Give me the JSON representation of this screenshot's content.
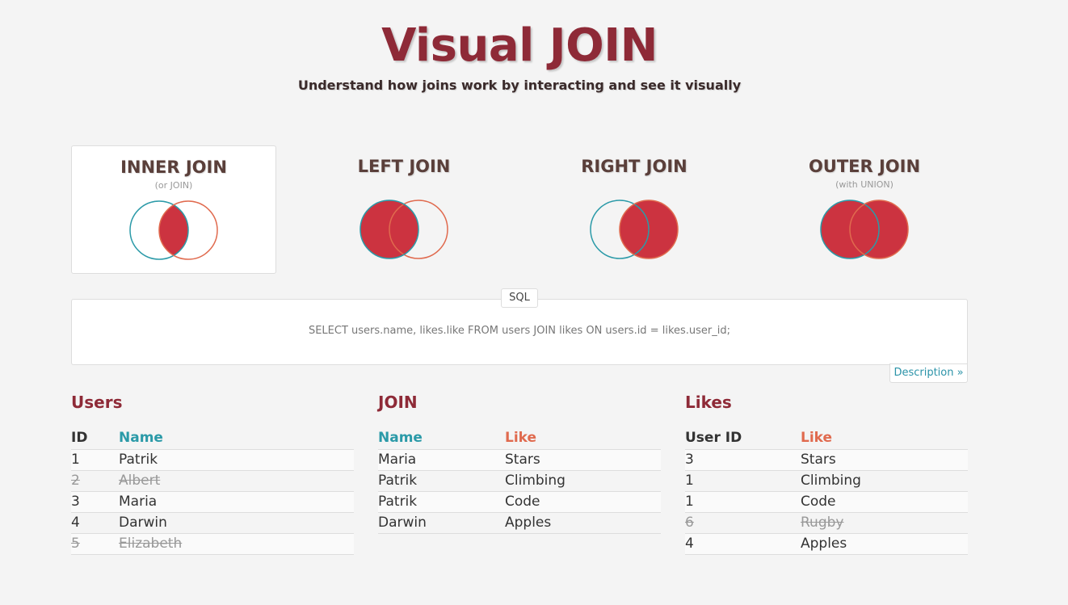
{
  "app": {
    "title": "Visual JOIN",
    "subtitle": "Understand how joins work by interacting and see it visually"
  },
  "colors": {
    "accent": "#8e2a37",
    "fill": "#cc3340",
    "left_circle": "#2b9aa8",
    "right_circle": "#e06a4e"
  },
  "joins": [
    {
      "label": "INNER JOIN",
      "sub": "(or JOIN)",
      "selected": true,
      "icon": "inner-join-venn-icon"
    },
    {
      "label": "LEFT JOIN",
      "sub": "",
      "selected": false,
      "icon": "left-join-venn-icon"
    },
    {
      "label": "RIGHT JOIN",
      "sub": "",
      "selected": false,
      "icon": "right-join-venn-icon"
    },
    {
      "label": "OUTER JOIN",
      "sub": "(with UNION)",
      "selected": false,
      "icon": "outer-join-venn-icon"
    }
  ],
  "sql": {
    "tab_label": "SQL",
    "query": "SELECT users.name, likes.like FROM users JOIN likes ON users.id = likes.user_id;",
    "description_link": "Description »"
  },
  "users": {
    "title": "Users",
    "columns": [
      "ID",
      "Name"
    ],
    "rows": [
      {
        "cells": [
          "1",
          "Patrik"
        ],
        "struck": false
      },
      {
        "cells": [
          "2",
          "Albert"
        ],
        "struck": true
      },
      {
        "cells": [
          "3",
          "Maria"
        ],
        "struck": false
      },
      {
        "cells": [
          "4",
          "Darwin"
        ],
        "struck": false
      },
      {
        "cells": [
          "5",
          "Elizabeth"
        ],
        "struck": true
      }
    ]
  },
  "join_result": {
    "title": "JOIN",
    "columns": [
      "Name",
      "Like"
    ],
    "rows": [
      {
        "cells": [
          "Maria",
          "Stars"
        ],
        "struck": false
      },
      {
        "cells": [
          "Patrik",
          "Climbing"
        ],
        "struck": false
      },
      {
        "cells": [
          "Patrik",
          "Code"
        ],
        "struck": false
      },
      {
        "cells": [
          "Darwin",
          "Apples"
        ],
        "struck": false
      }
    ]
  },
  "likes": {
    "title": "Likes",
    "columns": [
      "User ID",
      "Like"
    ],
    "rows": [
      {
        "cells": [
          "3",
          "Stars"
        ],
        "struck": false
      },
      {
        "cells": [
          "1",
          "Climbing"
        ],
        "struck": false
      },
      {
        "cells": [
          "1",
          "Code"
        ],
        "struck": false
      },
      {
        "cells": [
          "6",
          "Rugby"
        ],
        "struck": true
      },
      {
        "cells": [
          "4",
          "Apples"
        ],
        "struck": false
      }
    ]
  }
}
